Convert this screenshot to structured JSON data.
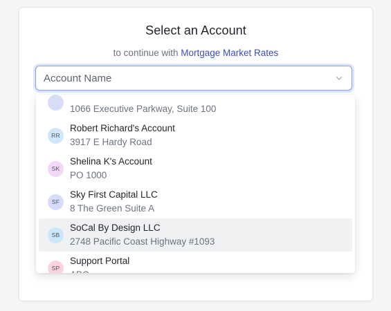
{
  "header": {
    "title": "Select an Account",
    "subtitle_prefix": "to continue with",
    "app_name": "Mortgage Market Rates"
  },
  "select": {
    "placeholder": "Account Name",
    "chevron_icon": "chevron-down-icon"
  },
  "colors": {
    "accent": "#3b4fb8",
    "focus_ring": "#8aa0e6",
    "active_row": "#f0f1f3"
  },
  "options": [
    {
      "initials": "",
      "name": "",
      "address": "1066 Executive Parkway, Suite 100",
      "avatar_color": "#d9dcf5"
    },
    {
      "initials": "RR",
      "name": "Robert Richard's Account",
      "address": "3917 E Hardy Road",
      "avatar_color": "#cfe6fb"
    },
    {
      "initials": "SK",
      "name": "Shelina K's Account",
      "address": "PO 1000",
      "avatar_color": "#f3d7f7"
    },
    {
      "initials": "SF",
      "name": "Sky First Capital LLC",
      "address": "8 The Green Suite A",
      "avatar_color": "#d6dcf9"
    },
    {
      "initials": "SB",
      "name": "SoCal By Design LLC",
      "address": "2748 Pacific Coast Highway #1093",
      "avatar_color": "#cbe6f8"
    },
    {
      "initials": "SP",
      "name": "Support Portal",
      "address": "ABC",
      "avatar_color": "#fad3dd"
    }
  ],
  "active_index": 4
}
